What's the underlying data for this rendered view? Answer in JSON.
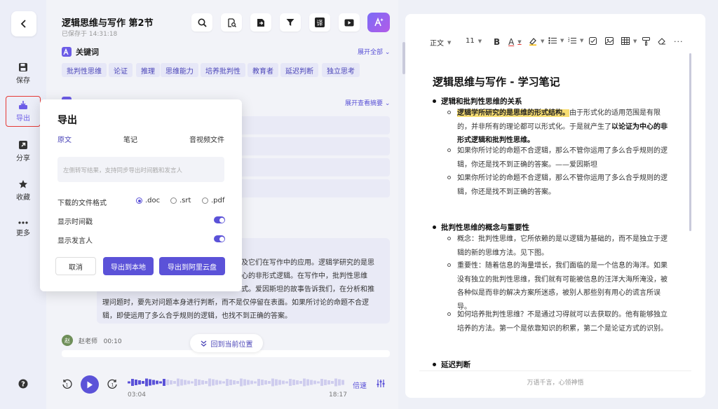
{
  "sidebar": {
    "items": [
      {
        "label": "保存",
        "icon": "save-icon"
      },
      {
        "label": "导出",
        "icon": "export-icon"
      },
      {
        "label": "分享",
        "icon": "share-icon"
      },
      {
        "label": "收藏",
        "icon": "star-icon"
      },
      {
        "label": "更多",
        "icon": "more-icon"
      }
    ]
  },
  "header": {
    "title": "逻辑思维与写作 第2节",
    "saved": "已保存于 14:31:18",
    "translate_label": "译"
  },
  "keywords": {
    "title": "关键词",
    "expand": "展开全部",
    "items": [
      "批判性思维",
      "论证",
      "推理",
      "思维能力",
      "培养批判性",
      "教育者",
      "延迟判断",
      "独立思考"
    ]
  },
  "summary": {
    "expand": "展开查看摘要"
  },
  "note": {
    "text": "及它们在写作中的应用。逻辑学研究的是思心的非形式逻辑。在写作中，批判性思维式。爱因斯坦的故事告诉我们，在分析和推理问题时，要先对问题本身进行判断，而不是仅停留在表面。如果所讨论的命题不合逻辑，即使运用了多么合乎规则的逻辑，也找不到正确的答案。",
    "line1": "及它们在写作中的应用。逻辑学研究的是思",
    "line2": "心的非形式逻辑。在写作中，批判性思维",
    "line3": "式。爱因斯坦的故事告诉我们，在分析和推",
    "line4": "理问题时，要先对问题本身进行判断，而不是仅停留在表面。如果所讨论的命题不合逻",
    "line5": "辑，即使运用了多么合乎规则的逻辑，也找不到正确的答案。"
  },
  "speaker": {
    "avatar": "赵",
    "name": "赵老师",
    "time": "00:10"
  },
  "return_button": "回到当前位置",
  "player": {
    "current": "03:04",
    "total": "18:17",
    "speed": "倍速",
    "progress": 0.17
  },
  "export_popup": {
    "title": "导出",
    "tabs": [
      "原文",
      "笔记",
      "音视频文件"
    ],
    "placeholder": "左侧转写结果，支持同步导出时间戳和发言人",
    "format_label": "下载的文件格式",
    "formats": [
      ".doc",
      ".srt",
      ".pdf"
    ],
    "selected_format": ".doc",
    "show_timestamp_label": "显示时间戳",
    "show_speaker_label": "显示发言人",
    "show_timestamp": true,
    "show_speaker": true,
    "cancel": "取消",
    "export_local": "导出到本地",
    "export_cloud": "导出到阿里云盘"
  },
  "editor": {
    "toolbar": {
      "style": "正文",
      "size": "11"
    },
    "heading": "逻辑思维与写作 - 学习笔记",
    "sections": [
      {
        "title": "逻辑和批判性思维的关系",
        "bullets": [
          {
            "highlight": "逻辑学所研究的是思维的形式结构。",
            "text": "由于形式化的适用范围是有限的，并非所有的理论都可以形式化。于是就产生了",
            "bold": "以论证为中心的非形式逻辑和批判性思维。"
          },
          {
            "text": "如果你所讨论的命题不合逻辑，那么不管你运用了多么合乎规则的逻辑，你还是找不到正确的答案。——爱因斯坦"
          },
          {
            "text": "如果你所讨论的命题不合逻辑，那么不管你运用了多么合乎规则的逻辑，你还是找不到正确的答案。"
          }
        ]
      },
      {
        "title": "批判性思维的概念与重要性",
        "bullets": [
          {
            "text": "概念：批判性思维，它所依赖的是以逻辑为基础的，而不是独立于逻辑的新的思维方法。见下图。"
          },
          {
            "text": "重要性：随着信息的海量增长，我们面临的是一个信息的海洋。如果没有独立的批判性思维，我们就有可能被信息的汪洋大海所淹没，被各种似是而非的解决方案所迷惑，被别人那些别有用心的谎言所误导。"
          },
          {
            "text": "如何培养批判性思维？不是通过习得就可以去获取的。他有能够独立培养的方法。第一个是依靠知识的积累，第二个是论证方式的识别。"
          }
        ]
      },
      {
        "title": "延迟判断"
      }
    ],
    "footer": "万语千言，心领神悟"
  }
}
